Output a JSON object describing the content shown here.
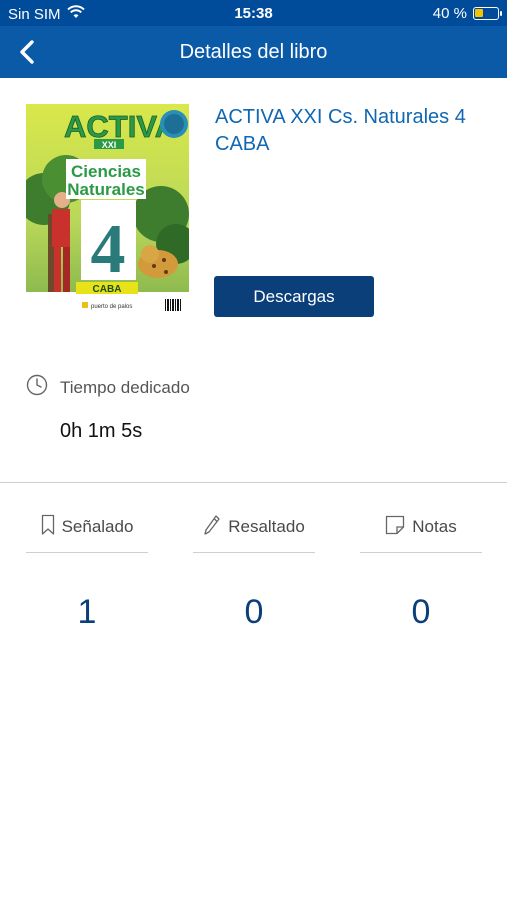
{
  "status_bar": {
    "carrier": "Sin SIM",
    "time": "15:38",
    "battery": "40 %",
    "battery_level": 0.4
  },
  "nav": {
    "title": "Detalles del libro",
    "back_icon": "chevron-left-icon"
  },
  "book": {
    "title": "ACTIVA XXI Cs. Naturales 4 CABA",
    "download_label": "Descargas",
    "cover": {
      "brand": "ACTIVA",
      "series": "XXI",
      "subject_line1": "Ciencias",
      "subject_line2": "Naturales",
      "grade": "4",
      "region": "CABA",
      "publisher": "puerto de palos"
    }
  },
  "time_spent": {
    "label": "Tiempo dedicado",
    "value": "0h 1m 5s",
    "icon": "clock-icon"
  },
  "stats": [
    {
      "label": "Señalado",
      "value": "1",
      "icon": "bookmark-icon"
    },
    {
      "label": "Resaltado",
      "value": "0",
      "icon": "pencil-icon"
    },
    {
      "label": "Notas",
      "value": "0",
      "icon": "note-icon"
    }
  ],
  "colors": {
    "status_bar": "#004c9a",
    "nav_bar": "#0a5aa8",
    "title_blue": "#1067b2",
    "button_dark": "#0a3f7a"
  }
}
